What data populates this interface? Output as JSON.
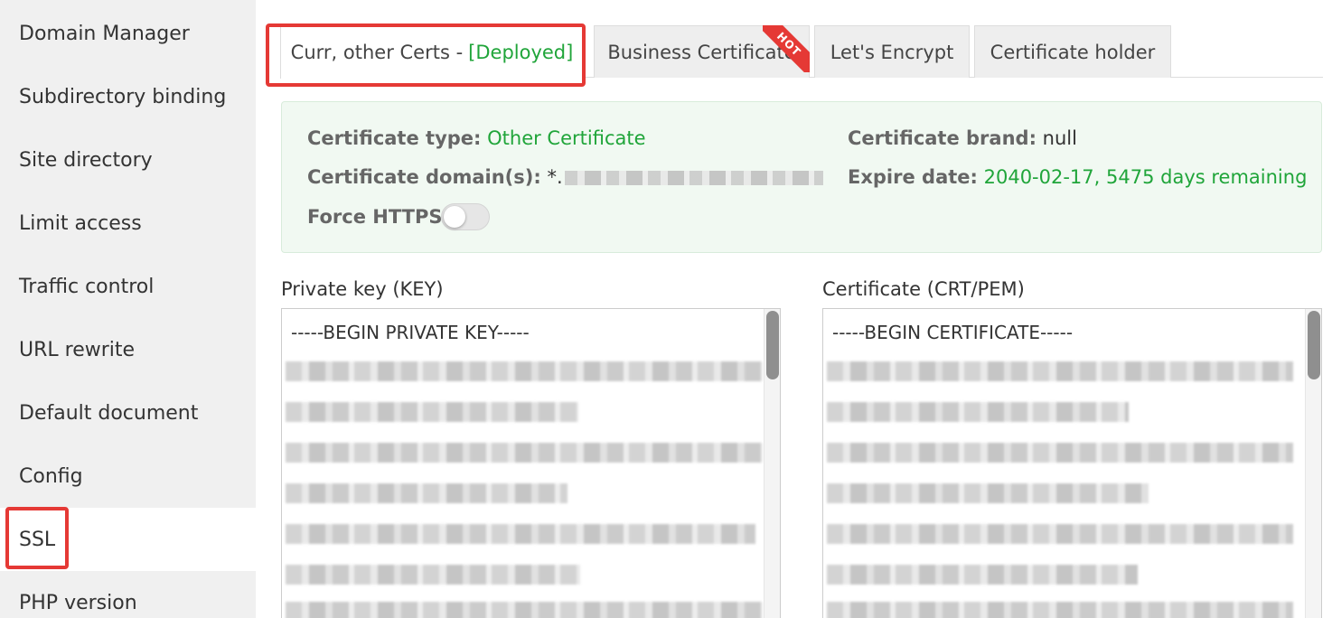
{
  "sidebar": {
    "items": [
      {
        "label": "Domain Manager"
      },
      {
        "label": "Subdirectory binding"
      },
      {
        "label": "Site directory"
      },
      {
        "label": "Limit access"
      },
      {
        "label": "Traffic control"
      },
      {
        "label": "URL rewrite"
      },
      {
        "label": "Default document"
      },
      {
        "label": "Config"
      },
      {
        "label": "SSL"
      },
      {
        "label": "PHP version"
      }
    ],
    "active": "SSL"
  },
  "tabs": [
    {
      "label": "Curr, other Certs -",
      "status": "[Deployed]"
    },
    {
      "label": "Business Certificate",
      "badge": "HOT"
    },
    {
      "label": "Let's Encrypt"
    },
    {
      "label": "Certificate holder"
    }
  ],
  "cert_info": {
    "type_label": "Certificate type:",
    "type_value": "Other Certificate",
    "brand_label": "Certificate brand:",
    "brand_value": "null",
    "domain_label": "Certificate domain(s):",
    "domain_value": "*.",
    "expire_label": "Expire date:",
    "expire_value": "2040-02-17, 5475 days remaining",
    "force_https_label": "Force HTTPS:",
    "force_https_enabled": false
  },
  "private_key": {
    "label": "Private key (KEY)",
    "first_line": "-----BEGIN PRIVATE KEY-----"
  },
  "certificate": {
    "label": "Certificate (CRT/PEM)",
    "first_line": "-----BEGIN CERTIFICATE-----"
  },
  "colors": {
    "accent_green": "#20a53a",
    "highlight_red": "#e53935",
    "info_bg": "#f1f9f2"
  }
}
